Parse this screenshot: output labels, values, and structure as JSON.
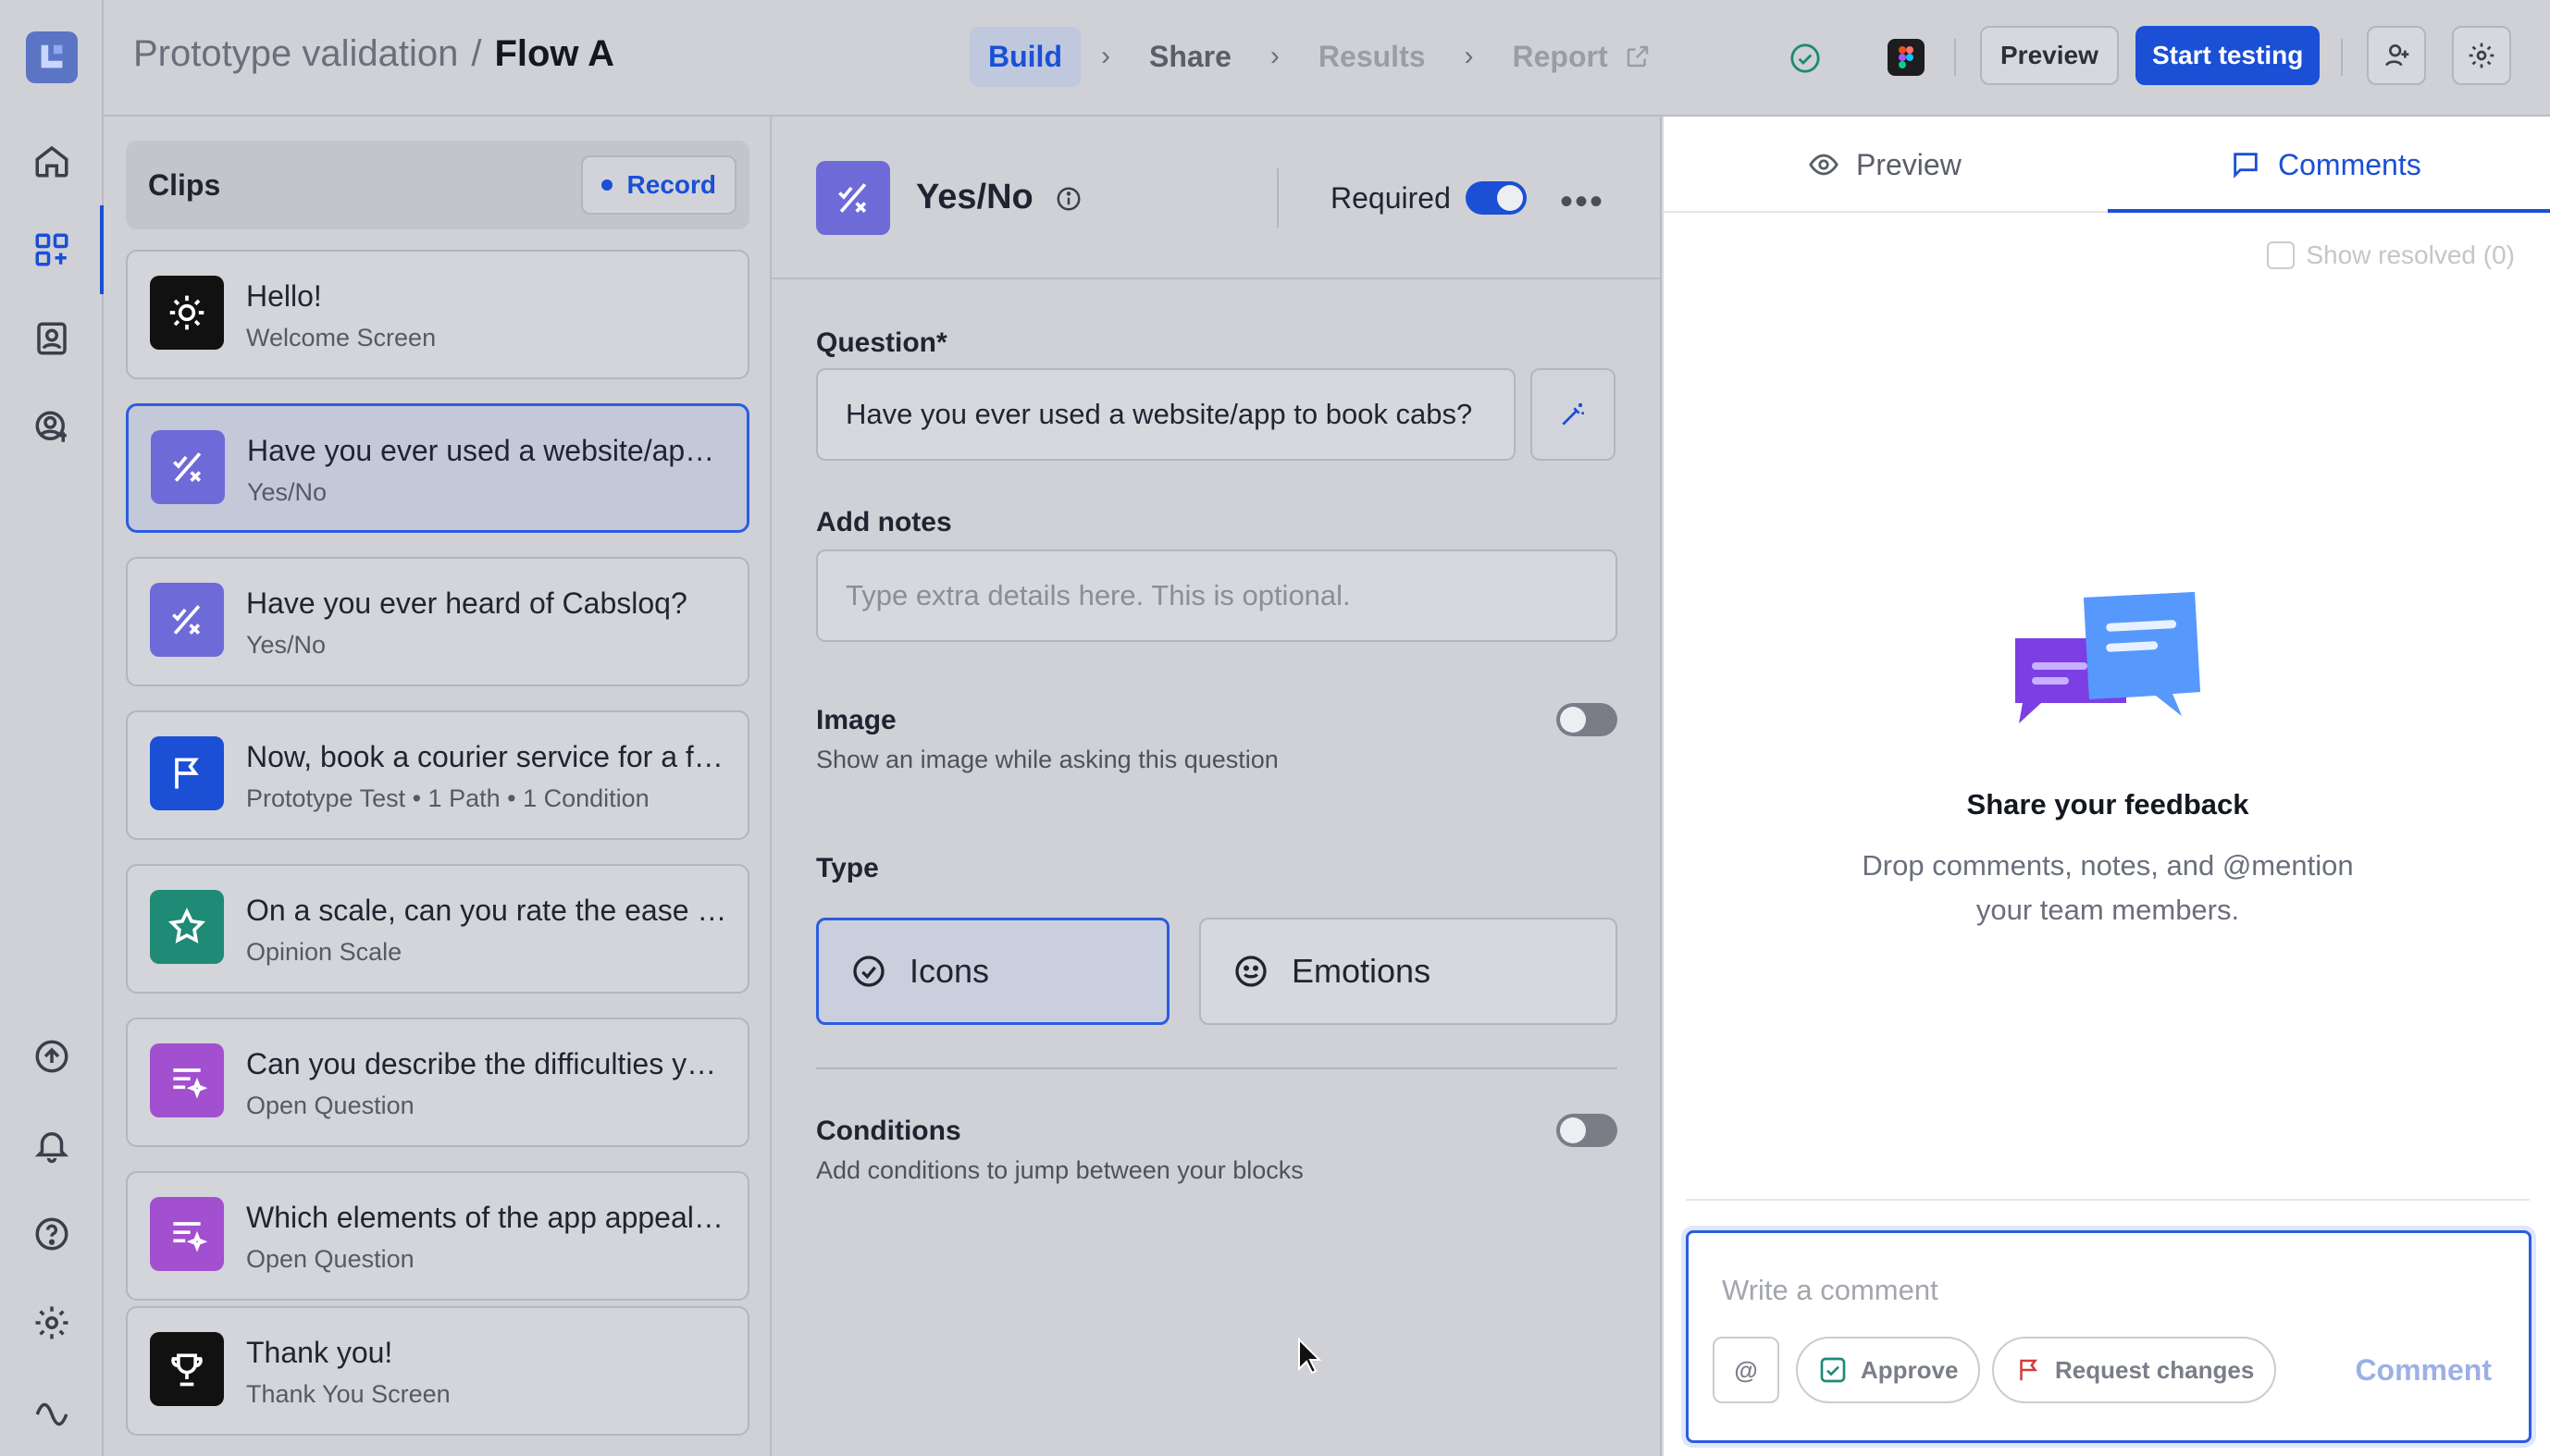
{
  "header": {
    "project": "Prototype validation",
    "separator": "/",
    "flow": "Flow A",
    "steps": [
      {
        "label": "Build"
      },
      {
        "label": "Share"
      },
      {
        "label": "Results"
      },
      {
        "label": "Report"
      }
    ],
    "preview_label": "Preview",
    "start_label": "Start testing"
  },
  "clips": {
    "title": "Clips",
    "record_label": "Record",
    "items": [
      {
        "title": "Hello!",
        "subtitle": "Welcome Screen",
        "icon": "sun-icon",
        "color": "#111111"
      },
      {
        "title": "Have you ever used a website/app to book cabs?",
        "subtitle": "Yes/No",
        "icon": "yes-no-icon",
        "color": "#6e6ad8"
      },
      {
        "title": "Have you ever heard of Cabsloq?",
        "subtitle": "Yes/No",
        "icon": "yes-no-icon",
        "color": "#6e6ad8"
      },
      {
        "title": "Now, book a courier service for a friend",
        "subtitle": "Prototype Test • 1 Path • 1 Condition",
        "icon": "flag-icon",
        "color": "#1a4fd6"
      },
      {
        "title": "On a scale, can you rate the ease of use?",
        "subtitle": "Opinion Scale",
        "icon": "star-icon",
        "color": "#1f8a76"
      },
      {
        "title": "Can you describe the difficulties you faced?",
        "subtitle": "Open Question",
        "icon": "text-sparkle-icon",
        "color": "#a24fd0"
      },
      {
        "title": "Which elements of the app appealed to you?",
        "subtitle": "Open Question",
        "icon": "text-sparkle-icon",
        "color": "#a24fd0"
      },
      {
        "title": "Thank you!",
        "subtitle": "Thank You Screen",
        "icon": "trophy-icon",
        "color": "#111111"
      }
    ]
  },
  "editor": {
    "block_name": "Yes/No",
    "required_label": "Required",
    "question_label": "Question*",
    "question_value": "Have you ever used a website/app to book cabs?",
    "notes_label": "Add notes",
    "notes_placeholder": "Type extra details here. This is optional.",
    "image_label": "Image",
    "image_desc": "Show an image while asking this question",
    "type_label": "Type",
    "type_icons": "Icons",
    "type_emotions": "Emotions",
    "conditions_label": "Conditions",
    "conditions_desc": "Add conditions to jump between your blocks"
  },
  "comments": {
    "tab_preview": "Preview",
    "tab_comments": "Comments",
    "show_resolved": "Show resolved (0)",
    "empty_title": "Share your feedback",
    "empty_desc": "Drop comments, notes, and @mention your team members.",
    "placeholder": "Write a comment",
    "mention": "@",
    "approve": "Approve",
    "request_changes": "Request changes",
    "submit": "Comment"
  }
}
